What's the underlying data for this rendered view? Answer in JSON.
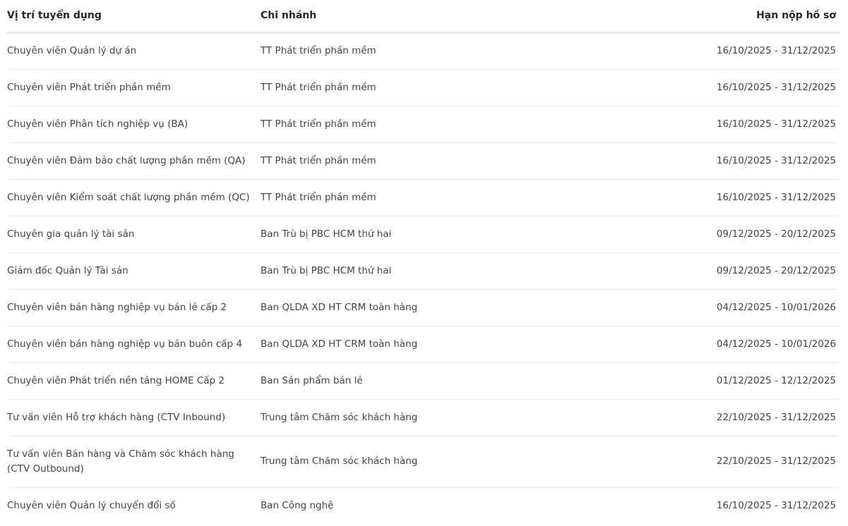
{
  "table": {
    "headers": {
      "position": "Vị trí tuyển dụng",
      "branch": "Chi nhánh",
      "deadline": "Hạn nộp hồ sơ"
    },
    "rows": [
      {
        "position": "Chuyên viên Quản lý dự án",
        "branch": "TT Phát triển phần mềm",
        "deadline": "16/10/2025 - 31/12/2025"
      },
      {
        "position": "Chuyên viên Phát triển phần mềm",
        "branch": "TT Phát triển phần mềm",
        "deadline": "16/10/2025 - 31/12/2025"
      },
      {
        "position": "Chuyên viên Phân tích nghiệp vụ (BA)",
        "branch": "TT Phát triển phần mềm",
        "deadline": "16/10/2025 - 31/12/2025"
      },
      {
        "position": "Chuyên viên Đảm bảo chất lượng phần mềm (QA)",
        "branch": "TT Phát triển phần mềm",
        "deadline": "16/10/2025 - 31/12/2025"
      },
      {
        "position": "Chuyên viên Kiểm soát chất lượng phần mềm (QC)",
        "branch": "TT Phát triển phần mềm",
        "deadline": "16/10/2025 - 31/12/2025"
      },
      {
        "position": "Chuyên gia quản lý tài sản",
        "branch": "Ban Trù bị PBC HCM thứ hai",
        "deadline": "09/12/2025 - 20/12/2025"
      },
      {
        "position": "Giám đốc Quản lý Tài sản",
        "branch": "Ban Trù bị PBC HCM thứ hai",
        "deadline": "09/12/2025 - 20/12/2025"
      },
      {
        "position": "Chuyên viên bán hàng nghiệp vụ bán lẻ cấp 2",
        "branch": "Ban QLDA XD HT CRM toàn hàng",
        "deadline": "04/12/2025 - 10/01/2026"
      },
      {
        "position": "Chuyên viên bán hàng nghiệp vụ bán buôn cấp 4",
        "branch": "Ban QLDA XD HT CRM toàn hàng",
        "deadline": "04/12/2025 - 10/01/2026"
      },
      {
        "position": "Chuyên viên Phát triển nền tảng HOME Cấp 2",
        "branch": "Ban Sản phẩm bán lẻ",
        "deadline": "01/12/2025 - 12/12/2025"
      },
      {
        "position": "Tư vấn viên Hỗ trợ khách hàng (CTV Inbound)",
        "branch": "Trung tâm Chăm sóc khách hàng",
        "deadline": "22/10/2025 - 31/12/2025"
      },
      {
        "position": "Tư vấn viên Bán hàng và Chăm sóc khách hàng (CTV Outbound)",
        "branch": "Trung tâm Chăm sóc khách hàng",
        "deadline": "22/10/2025 - 31/12/2025"
      },
      {
        "position": "Chuyên viên Quản lý chuyển đổi số",
        "branch": "Ban Công nghệ",
        "deadline": "16/10/2025 - 31/12/2025"
      }
    ]
  }
}
